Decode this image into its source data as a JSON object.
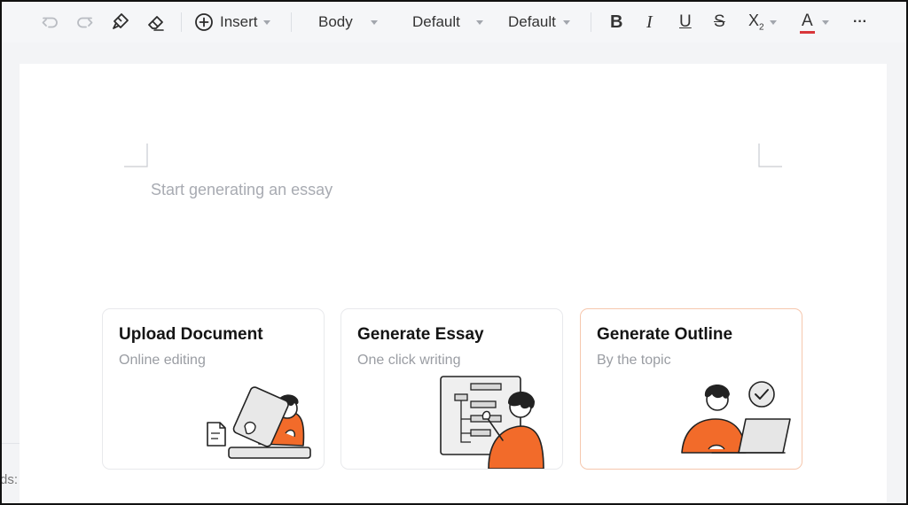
{
  "toolbar": {
    "undo_icon": "undo-icon",
    "redo_icon": "redo-icon",
    "format_painter_icon": "format-painter-icon",
    "eraser_icon": "eraser-icon",
    "insert_label": "Insert",
    "paragraph_style": "Body",
    "font_family": "Default",
    "font_size": "Default",
    "bold_label": "B",
    "italic_label": "I",
    "underline_label": "U",
    "strike_label": "S",
    "subscript_label": "X",
    "subscript_small": "2",
    "font_color_label": "A",
    "font_color": "#d8363a",
    "more_label": "···"
  },
  "editor": {
    "placeholder": "Start generating an essay"
  },
  "cards": [
    {
      "title": "Upload Document",
      "subtitle": "Online editing"
    },
    {
      "title": "Generate Essay",
      "subtitle": "One click writing"
    },
    {
      "title": "Generate Outline",
      "subtitle": "By the topic"
    }
  ],
  "colors": {
    "accent_orange": "#f26b2a",
    "active_card_border": "#f6c7ad"
  },
  "left_strip_text": "ds:"
}
